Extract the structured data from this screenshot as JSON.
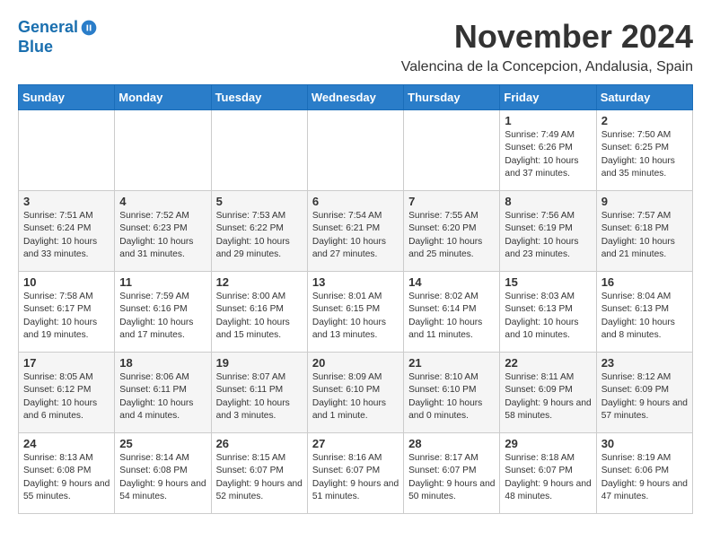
{
  "logo": {
    "line1": "General",
    "line2": "Blue"
  },
  "title": "November 2024",
  "location": "Valencina de la Concepcion, Andalusia, Spain",
  "days_of_week": [
    "Sunday",
    "Monday",
    "Tuesday",
    "Wednesday",
    "Thursday",
    "Friday",
    "Saturday"
  ],
  "weeks": [
    [
      {
        "day": "",
        "content": ""
      },
      {
        "day": "",
        "content": ""
      },
      {
        "day": "",
        "content": ""
      },
      {
        "day": "",
        "content": ""
      },
      {
        "day": "",
        "content": ""
      },
      {
        "day": "1",
        "content": "Sunrise: 7:49 AM\nSunset: 6:26 PM\nDaylight: 10 hours and 37 minutes."
      },
      {
        "day": "2",
        "content": "Sunrise: 7:50 AM\nSunset: 6:25 PM\nDaylight: 10 hours and 35 minutes."
      }
    ],
    [
      {
        "day": "3",
        "content": "Sunrise: 7:51 AM\nSunset: 6:24 PM\nDaylight: 10 hours and 33 minutes."
      },
      {
        "day": "4",
        "content": "Sunrise: 7:52 AM\nSunset: 6:23 PM\nDaylight: 10 hours and 31 minutes."
      },
      {
        "day": "5",
        "content": "Sunrise: 7:53 AM\nSunset: 6:22 PM\nDaylight: 10 hours and 29 minutes."
      },
      {
        "day": "6",
        "content": "Sunrise: 7:54 AM\nSunset: 6:21 PM\nDaylight: 10 hours and 27 minutes."
      },
      {
        "day": "7",
        "content": "Sunrise: 7:55 AM\nSunset: 6:20 PM\nDaylight: 10 hours and 25 minutes."
      },
      {
        "day": "8",
        "content": "Sunrise: 7:56 AM\nSunset: 6:19 PM\nDaylight: 10 hours and 23 minutes."
      },
      {
        "day": "9",
        "content": "Sunrise: 7:57 AM\nSunset: 6:18 PM\nDaylight: 10 hours and 21 minutes."
      }
    ],
    [
      {
        "day": "10",
        "content": "Sunrise: 7:58 AM\nSunset: 6:17 PM\nDaylight: 10 hours and 19 minutes."
      },
      {
        "day": "11",
        "content": "Sunrise: 7:59 AM\nSunset: 6:16 PM\nDaylight: 10 hours and 17 minutes."
      },
      {
        "day": "12",
        "content": "Sunrise: 8:00 AM\nSunset: 6:16 PM\nDaylight: 10 hours and 15 minutes."
      },
      {
        "day": "13",
        "content": "Sunrise: 8:01 AM\nSunset: 6:15 PM\nDaylight: 10 hours and 13 minutes."
      },
      {
        "day": "14",
        "content": "Sunrise: 8:02 AM\nSunset: 6:14 PM\nDaylight: 10 hours and 11 minutes."
      },
      {
        "day": "15",
        "content": "Sunrise: 8:03 AM\nSunset: 6:13 PM\nDaylight: 10 hours and 10 minutes."
      },
      {
        "day": "16",
        "content": "Sunrise: 8:04 AM\nSunset: 6:13 PM\nDaylight: 10 hours and 8 minutes."
      }
    ],
    [
      {
        "day": "17",
        "content": "Sunrise: 8:05 AM\nSunset: 6:12 PM\nDaylight: 10 hours and 6 minutes."
      },
      {
        "day": "18",
        "content": "Sunrise: 8:06 AM\nSunset: 6:11 PM\nDaylight: 10 hours and 4 minutes."
      },
      {
        "day": "19",
        "content": "Sunrise: 8:07 AM\nSunset: 6:11 PM\nDaylight: 10 hours and 3 minutes."
      },
      {
        "day": "20",
        "content": "Sunrise: 8:09 AM\nSunset: 6:10 PM\nDaylight: 10 hours and 1 minute."
      },
      {
        "day": "21",
        "content": "Sunrise: 8:10 AM\nSunset: 6:10 PM\nDaylight: 10 hours and 0 minutes."
      },
      {
        "day": "22",
        "content": "Sunrise: 8:11 AM\nSunset: 6:09 PM\nDaylight: 9 hours and 58 minutes."
      },
      {
        "day": "23",
        "content": "Sunrise: 8:12 AM\nSunset: 6:09 PM\nDaylight: 9 hours and 57 minutes."
      }
    ],
    [
      {
        "day": "24",
        "content": "Sunrise: 8:13 AM\nSunset: 6:08 PM\nDaylight: 9 hours and 55 minutes."
      },
      {
        "day": "25",
        "content": "Sunrise: 8:14 AM\nSunset: 6:08 PM\nDaylight: 9 hours and 54 minutes."
      },
      {
        "day": "26",
        "content": "Sunrise: 8:15 AM\nSunset: 6:07 PM\nDaylight: 9 hours and 52 minutes."
      },
      {
        "day": "27",
        "content": "Sunrise: 8:16 AM\nSunset: 6:07 PM\nDaylight: 9 hours and 51 minutes."
      },
      {
        "day": "28",
        "content": "Sunrise: 8:17 AM\nSunset: 6:07 PM\nDaylight: 9 hours and 50 minutes."
      },
      {
        "day": "29",
        "content": "Sunrise: 8:18 AM\nSunset: 6:07 PM\nDaylight: 9 hours and 48 minutes."
      },
      {
        "day": "30",
        "content": "Sunrise: 8:19 AM\nSunset: 6:06 PM\nDaylight: 9 hours and 47 minutes."
      }
    ]
  ]
}
